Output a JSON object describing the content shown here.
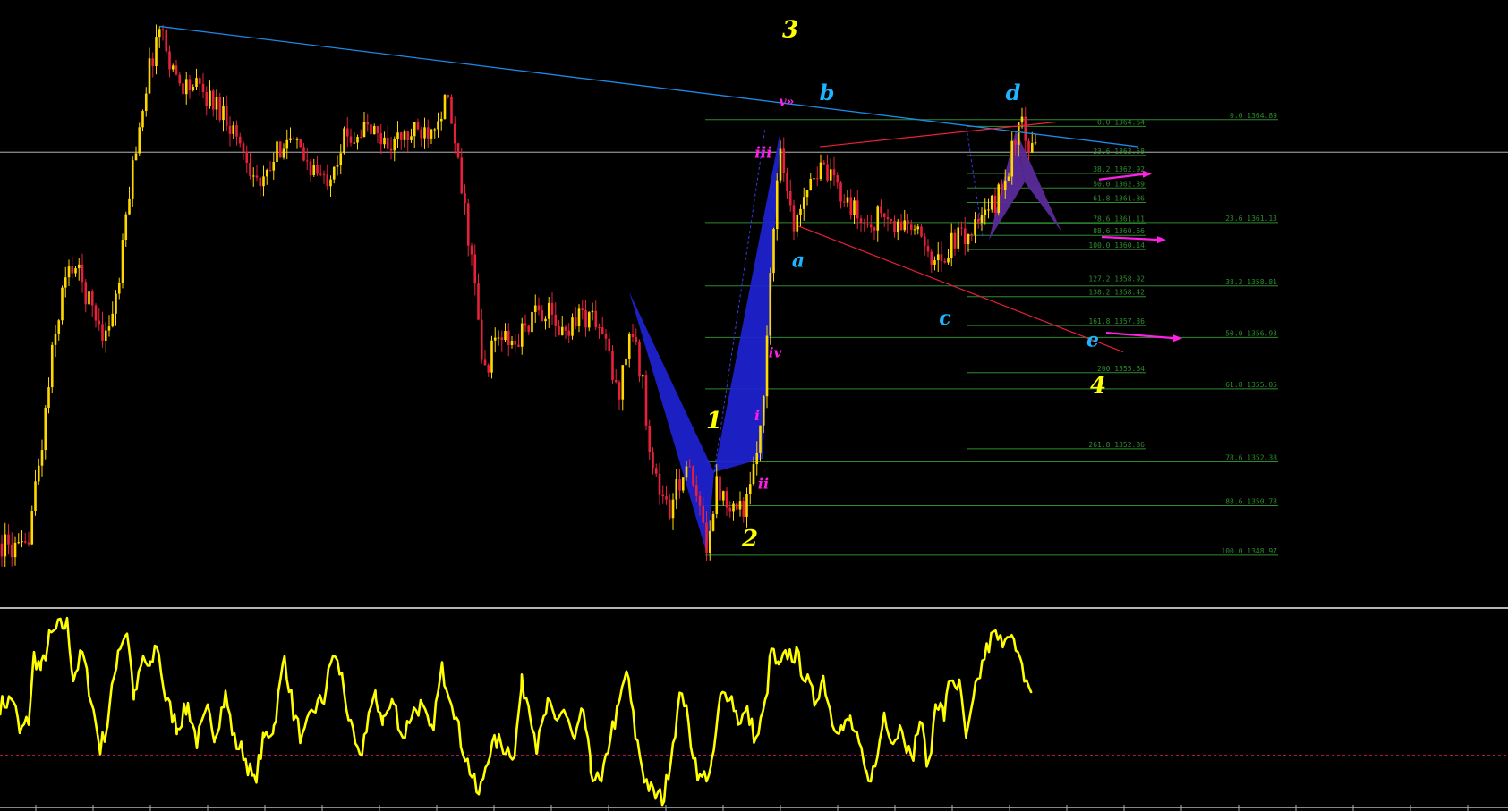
{
  "chart_data": {
    "type": "candlestick",
    "symbol_hidden": true,
    "price_pane": {
      "ylim": [
        1347.3,
        1369.0
      ],
      "xlim": [
        0,
        1685
      ],
      "candles_count": 310,
      "colors": {
        "up": "#ffd800",
        "down": "#e8203a",
        "background": "#000000"
      },
      "wave_labels": [
        {
          "text": "3",
          "color": "#ffff00",
          "size": 26,
          "x": 883,
          "price": 1367.9
        },
        {
          "text": "b",
          "color": "#1eb4ff",
          "size": 24,
          "x": 924,
          "price": 1365.6
        },
        {
          "text": "d",
          "color": "#1eb4ff",
          "size": 24,
          "x": 1132,
          "price": 1365.6
        },
        {
          "text": "v»",
          "color": "#ff20e8",
          "size": 14,
          "x": 879,
          "price": 1365.4
        },
        {
          "text": "iii",
          "color": "#ff20e8",
          "size": 17,
          "x": 853,
          "price": 1363.5
        },
        {
          "text": "a",
          "color": "#1eb4ff",
          "size": 22,
          "x": 892,
          "price": 1359.5
        },
        {
          "text": "c",
          "color": "#1eb4ff",
          "size": 22,
          "x": 1056,
          "price": 1357.4
        },
        {
          "text": "e",
          "color": "#1eb4ff",
          "size": 22,
          "x": 1221,
          "price": 1356.6
        },
        {
          "text": "iv",
          "color": "#ff20e8",
          "size": 15,
          "x": 866,
          "price": 1356.2
        },
        {
          "text": "4",
          "color": "#ffff00",
          "size": 26,
          "x": 1227,
          "price": 1354.9
        },
        {
          "text": "1",
          "color": "#ffff00",
          "size": 26,
          "x": 798,
          "price": 1353.6
        },
        {
          "text": "i",
          "color": "#ff20e8",
          "size": 16,
          "x": 846,
          "price": 1353.9
        },
        {
          "text": "ii",
          "color": "#ff20e8",
          "size": 16,
          "x": 853,
          "price": 1351.4
        },
        {
          "text": "2",
          "color": "#ffff00",
          "size": 26,
          "x": 838,
          "price": 1349.3
        }
      ],
      "fib_right": [
        {
          "label": "0.0 1364.89",
          "price": 1364.89
        },
        {
          "label": "23.6 1361.13",
          "price": 1361.13
        },
        {
          "label": "38.2 1358.81",
          "price": 1358.81
        },
        {
          "label": "50.0 1356.93",
          "price": 1356.93
        },
        {
          "label": "61.8 1355.05",
          "price": 1355.05
        },
        {
          "label": "78.6 1352.38",
          "price": 1352.38
        },
        {
          "label": "88.6 1350.78",
          "price": 1350.78
        },
        {
          "label": "100.0 1348.97",
          "price": 1348.97
        }
      ],
      "fib_left": [
        {
          "label": "0.0 1364.64",
          "price": 1364.64
        },
        {
          "label": "23.6 1363.58",
          "price": 1363.58
        },
        {
          "label": "38.2 1362.92",
          "price": 1362.92
        },
        {
          "label": "50.0 1362.39",
          "price": 1362.39
        },
        {
          "label": "61.8 1361.86",
          "price": 1361.86
        },
        {
          "label": "78.6 1361.11",
          "price": 1361.11
        },
        {
          "label": "88.6 1360.66",
          "price": 1360.66
        },
        {
          "label": "100.0 1360.14",
          "price": 1360.14
        },
        {
          "label": "127.2 1358.92",
          "price": 1358.92
        },
        {
          "label": "138.2 1358.42",
          "price": 1358.42
        },
        {
          "label": "161.8 1357.36",
          "price": 1357.36
        },
        {
          "label": "200 1355.64",
          "price": 1355.64
        },
        {
          "label": "261.8 1352.86",
          "price": 1352.86
        }
      ],
      "horizontal_line_price": 1363.7
    },
    "oscillator_pane": {
      "line_color": "#ffff00",
      "zero_line_color": "#b0105a",
      "ylim": [
        -35,
        100
      ]
    },
    "colors": {
      "grid_border": "#b4b4b4",
      "trendline": "#1e88e5",
      "channel": "#e8203a",
      "fib": "#2e8b2e",
      "pattern_blue": "#1e22d2",
      "pattern_purple": "#5a2a9a",
      "arrow": "#ff20e8"
    }
  }
}
